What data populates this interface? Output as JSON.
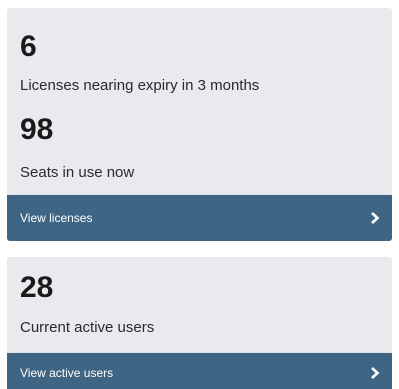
{
  "licenses_card": {
    "expiring_count": "6",
    "expiring_label": "Licenses nearing expiry in 3 months",
    "seats_count": "98",
    "seats_label": "Seats in use now",
    "button_label": "View licenses",
    "button_icon": "chevron-right-icon"
  },
  "users_card": {
    "active_count": "28",
    "active_label": "Current active users",
    "button_label": "View active users",
    "button_icon": "chevron-right-icon"
  },
  "colors": {
    "card_background": "#e8eaee",
    "button_background": "#3e6583",
    "button_text": "#ffffff",
    "stat_text": "#1a1a1a"
  }
}
